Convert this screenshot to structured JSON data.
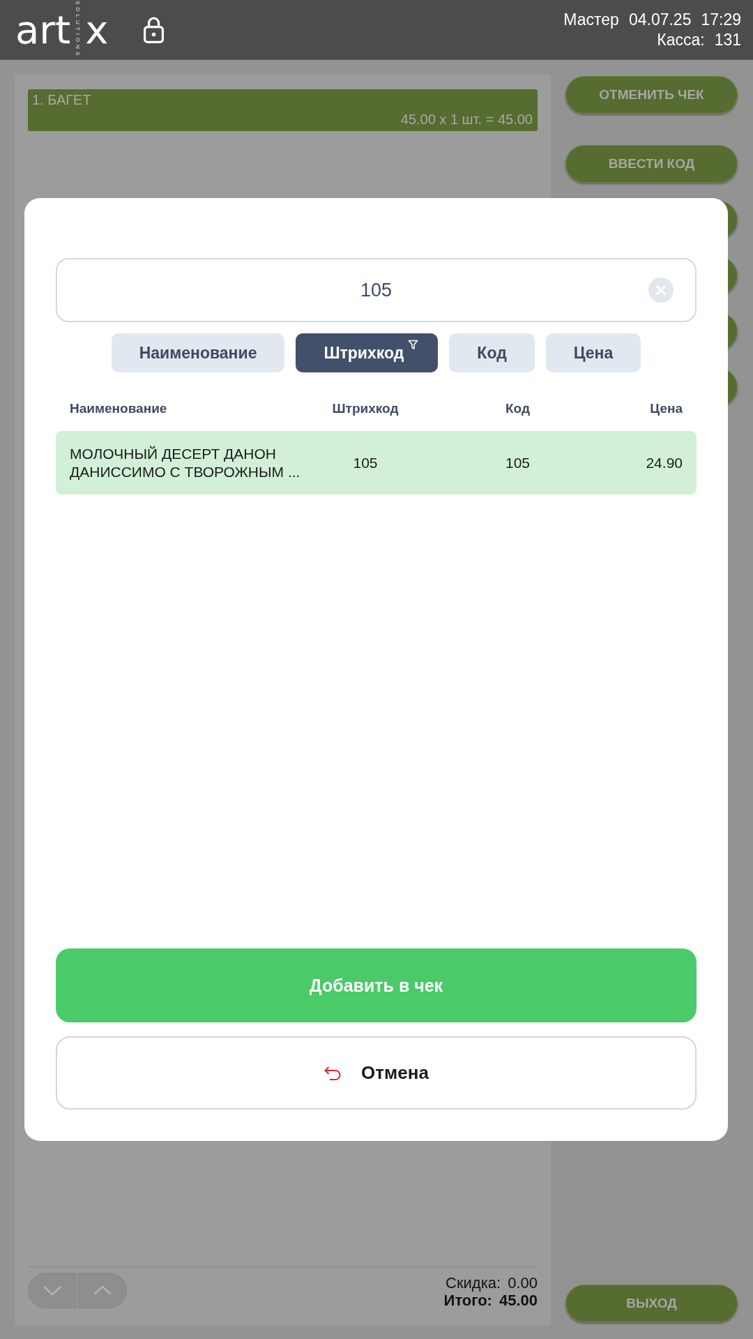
{
  "header": {
    "logo": {
      "word": "art",
      "tagline": "SOLUTIONS",
      "letter": "x"
    },
    "user": "Мастер",
    "date": "04.07.25",
    "time": "17:29",
    "register_label": "Касса:",
    "register_number": "131"
  },
  "receipt": {
    "items": [
      {
        "name": "1. БАГЕТ",
        "calculation": "45.00 x 1 шт. = 45.00",
        "selected": true
      }
    ],
    "discount": {
      "label": "Скидка:",
      "value": "0.00"
    },
    "total": {
      "label": "Итого:",
      "value": "45.00"
    }
  },
  "side_buttons": [
    {
      "kind": "labeled",
      "label": "ОТМЕНИТЬ ЧЕК"
    },
    {
      "kind": "labeled",
      "label": "ВВЕСТИ КОД"
    },
    {
      "kind": "covered"
    },
    {
      "kind": "covered"
    },
    {
      "kind": "covered"
    },
    {
      "kind": "covered"
    }
  ],
  "exit_button": {
    "label": "ВЫХОД"
  },
  "dialog": {
    "search": {
      "value": "105"
    },
    "tabs": [
      {
        "label": "Наименование",
        "selected": false
      },
      {
        "label": "Штрихкод",
        "selected": true
      },
      {
        "label": "Код",
        "selected": false
      },
      {
        "label": "Цена",
        "selected": false
      }
    ],
    "table": {
      "columns": [
        "Наименование",
        "Штрихкод",
        "Код",
        "Цена"
      ],
      "rows": [
        {
          "cells": [
            "МОЛОЧНЫЙ ДЕСЕРТ ДАНОН ДАНИССИМО С ТВОРОЖНЫМ ...",
            "105",
            "105",
            "24.90"
          ],
          "selected": true
        }
      ]
    },
    "add_button": {
      "label": "Добавить в чек"
    },
    "cancel_button": {
      "label": "Отмена"
    }
  }
}
